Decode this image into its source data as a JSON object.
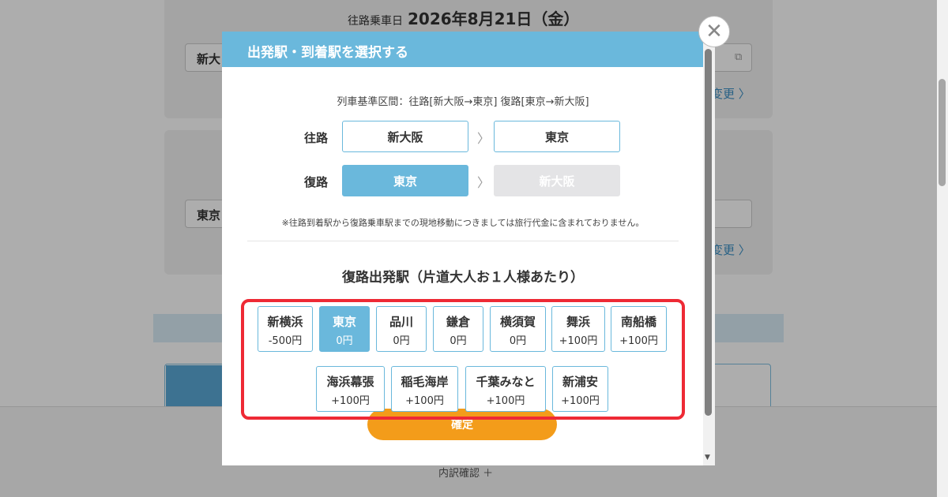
{
  "background": {
    "date_label": "往路乗車日",
    "date_value": "2026年8月21日（金）",
    "field1": "新大",
    "field2": "東京",
    "change1": "変更 〉",
    "change2": "変更 〉",
    "breakdown": "内訳確認 ＋"
  },
  "modal": {
    "title": "出発駅・到着駅を選択する",
    "section_info": "列車基準区間：往路[新大阪→東京] 復路[東京→新大阪]",
    "outbound_label": "往路",
    "outbound_from": "新大阪",
    "outbound_to": "東京",
    "return_label": "復路",
    "return_from": "東京",
    "return_to": "新大阪",
    "note": "※往路到着駅から復路乗車駅までの現地移動につきましては旅行代金に含まれておりません。",
    "section_title": "復路出発駅（片道大人お１人様あたり）",
    "stations": [
      {
        "name": "新横浜",
        "price": "-500円",
        "selected": false
      },
      {
        "name": "東京",
        "price": "0円",
        "selected": true
      },
      {
        "name": "品川",
        "price": "0円",
        "selected": false
      },
      {
        "name": "鎌倉",
        "price": "0円",
        "selected": false
      },
      {
        "name": "横須賀",
        "price": "0円",
        "selected": false
      },
      {
        "name": "舞浜",
        "price": "+100円",
        "selected": false
      },
      {
        "name": "南船橋",
        "price": "+100円",
        "selected": false
      },
      {
        "name": "海浜幕張",
        "price": "+100円",
        "selected": false
      },
      {
        "name": "稲毛海岸",
        "price": "+100円",
        "selected": false
      },
      {
        "name": "千葉みなと",
        "price": "+100円",
        "selected": false
      },
      {
        "name": "新浦安",
        "price": "+100円",
        "selected": false
      }
    ],
    "confirm_label": "確定"
  },
  "colors": {
    "accent": "#6ab8dc",
    "confirm": "#f39c1a",
    "highlight": "#ee2a35"
  }
}
